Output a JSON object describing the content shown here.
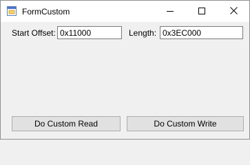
{
  "window": {
    "title": "FormCustom",
    "icon": "form-app-icon",
    "caption_buttons": [
      "minimize-icon",
      "maximize-icon",
      "close-icon"
    ]
  },
  "fields": {
    "start_offset": {
      "label": "Start Offset:",
      "value": "0x11000"
    },
    "length": {
      "label": "Length:",
      "value": "0x3EC000"
    }
  },
  "buttons": {
    "read_label": "Do Custom Read",
    "write_label": "Do Custom Write"
  },
  "colors": {
    "window_bg": "#f0f0f0",
    "titlebar_bg": "#ffffff",
    "focus_border": "#0078d7",
    "button_bg": "#e1e1e1",
    "button_border": "#adadad"
  }
}
